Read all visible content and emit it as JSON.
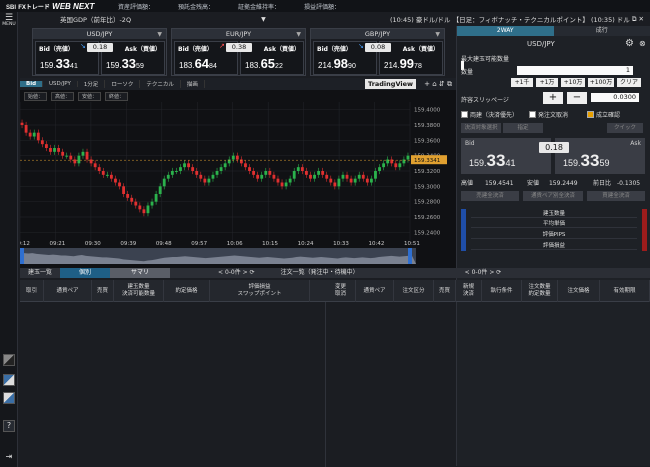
{
  "app": {
    "brand_small": "SBI",
    "brand": "FXトレード",
    "product": "WEB NEXT"
  },
  "account": [
    "資産評価額：",
    "預託金残高：",
    "証拠金維持率：",
    "損益評価額："
  ],
  "menu_label": "MENU",
  "ticker": {
    "left": "英国GDP（前年比）-2Q",
    "time1": "(10:45) 豪ドル/ドル",
    "news": "【日足：フィボナッチ・テクニカルポイント】",
    "time2": "(10:35) ドル"
  },
  "rates": [
    {
      "pair": "USD/JPY",
      "spread": "0.18",
      "bid_label": "Bid（売値）",
      "ask_label": "Ask（買値）",
      "bid_a": "159.",
      "bid_b": "33",
      "bid_c": "41",
      "ask_a": "159.",
      "ask_b": "33",
      "ask_c": "59",
      "dir": "down"
    },
    {
      "pair": "EUR/JPY",
      "spread": "0.38",
      "bid_label": "Bid（売値）",
      "ask_label": "Ask（買値）",
      "bid_a": "183.",
      "bid_b": "64",
      "bid_c": "84",
      "ask_a": "183.",
      "ask_b": "65",
      "ask_c": "22",
      "dir": "up"
    },
    {
      "pair": "GBP/JPY",
      "spread": "0.08",
      "bid_label": "Bid（売値）",
      "ask_label": "Ask（買値）",
      "bid_a": "214.",
      "bid_b": "98",
      "bid_c": "90",
      "ask_a": "214.",
      "ask_b": "99",
      "ask_c": "78",
      "dir": "down"
    }
  ],
  "chart_toolbar": {
    "side": "Bid",
    "pair": "USD/JPY",
    "interval": "1分足",
    "type": "ローソク",
    "tech": "テクニカル",
    "draw": "描画",
    "tv": "TradingView"
  },
  "ohlc_labels": [
    "始値：",
    "高値：",
    "安値：",
    "終値："
  ],
  "chart_data": {
    "type": "candlestick",
    "yticks": [
      "159.4000",
      "159.3900",
      "159.3800",
      "159.3700",
      "159.3600",
      "159.3500",
      "159.3400",
      "159.3300",
      "159.3200",
      "159.3100",
      "159.3000",
      "159.2900",
      "159.2800",
      "159.2700",
      "159.2600",
      "159.2500",
      "159.2400"
    ],
    "xticks": [
      "09:12",
      "09:21",
      "09:30",
      "09:39",
      "09:48",
      "09:57",
      "10:06",
      "10:15",
      "10:24",
      "10:33",
      "10:42",
      "10:51"
    ],
    "ylim": [
      159.23,
      159.41
    ],
    "last": "159.3341",
    "closes": [
      159.38,
      159.37,
      159.365,
      159.37,
      159.36,
      159.355,
      159.35,
      159.345,
      159.35,
      159.345,
      159.34,
      159.34,
      159.335,
      159.33,
      159.34,
      159.345,
      159.335,
      159.33,
      159.325,
      159.32,
      159.315,
      159.315,
      159.31,
      159.305,
      159.3,
      159.29,
      159.285,
      159.28,
      159.275,
      159.27,
      159.265,
      159.275,
      159.28,
      159.29,
      159.3,
      159.31,
      159.315,
      159.32,
      159.32,
      159.325,
      159.33,
      159.325,
      159.32,
      159.315,
      159.31,
      159.305,
      159.31,
      159.315,
      159.32,
      159.325,
      159.33,
      159.335,
      159.34,
      159.335,
      159.33,
      159.325,
      159.32,
      159.315,
      159.31,
      159.315,
      159.32,
      159.315,
      159.31,
      159.305,
      159.3,
      159.305,
      159.31,
      159.32,
      159.325,
      159.32,
      159.315,
      159.31,
      159.315,
      159.32,
      159.315,
      159.31,
      159.305,
      159.3,
      159.31,
      159.315,
      159.31,
      159.305,
      159.31,
      159.315,
      159.31,
      159.305,
      159.31,
      159.32,
      159.325,
      159.33,
      159.335,
      159.33,
      159.325,
      159.33,
      159.335,
      159.34
    ]
  },
  "order_panel": {
    "tab1": "2WAY",
    "tab2": "成行",
    "pair": "USD/JPY",
    "max_qty_label": "最大建玉可能数量",
    "qty_label": "数量",
    "qty_value": "1",
    "quick": [
      "+1千",
      "+1万",
      "+10万",
      "+100万",
      "クリア"
    ],
    "slip_label": "許容スリッページ",
    "slip_value": "0.0300",
    "check1": "両建（決済優先）",
    "check2": "発注文取消",
    "check3": "成立確認",
    "settle_label": "決済対象選択",
    "settle_val": "指定",
    "order_type": "クイック",
    "bid": "Bid",
    "ask": "Ask",
    "spread": "0.18",
    "bid_big": "159.",
    "bid_b": "33",
    "bid_c": "41",
    "ask_big": "159.",
    "ask_b": "33",
    "ask_c": "59",
    "high_label": "高値",
    "high": "159.4541",
    "low_label": "安値",
    "low": "159.2449",
    "prev_label": "前日比",
    "prev": "-0.1305",
    "btns": [
      "売建全決済",
      "通貨ペア別全決済",
      "買建全決済"
    ],
    "stats": [
      "建玉数量",
      "平均単価",
      "評価PIPS",
      "評価損益"
    ]
  },
  "bottom": {
    "tab_list": "建玉一覧",
    "tab_on": "個別",
    "tab_sum": "サマリ",
    "count_left": "0-0件",
    "order_list": "注文一覧（発注中・待機中）",
    "count_right": "0-0件",
    "cols_left": [
      "取引",
      "通貨ペア",
      "売買",
      "建玉数量\n決済可能数量",
      "約定価格",
      "評価損益\nスワップポイント"
    ],
    "cols_right": [
      "変更\n取消",
      "通貨ペア",
      "注文区分",
      "売買",
      "新規\n決済",
      "執行条件",
      "注文数量\n約定数量",
      "注文価格",
      "有効期限"
    ]
  }
}
